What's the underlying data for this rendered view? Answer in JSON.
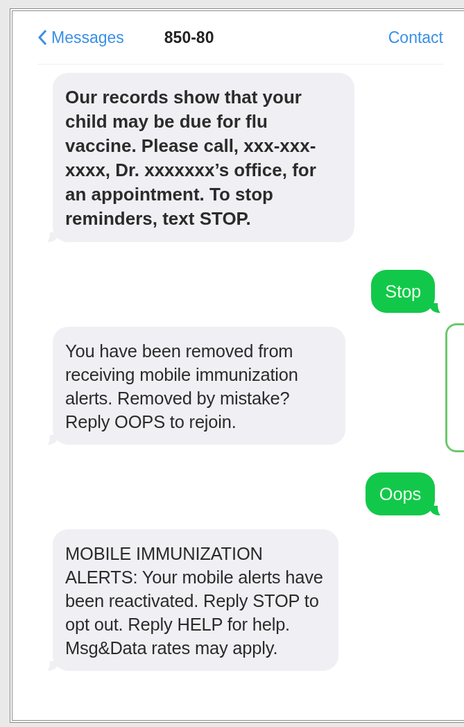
{
  "header": {
    "back": "Messages",
    "title": "850-80",
    "action": "Contact"
  },
  "messages": [
    {
      "kind": "incoming",
      "bold": true,
      "text": "Our records show that your child may be due for flu vaccine. Please call, xxx-xxx-xxxx, Dr. xxxxxxx’s office, for an appointment. To stop reminders, text STOP."
    },
    {
      "kind": "outgoing",
      "bold": false,
      "text": "Stop"
    },
    {
      "kind": "incoming",
      "bold": false,
      "text": "You have been removed from receiving mobile immunization alerts. Removed by mistake? Reply OOPS to rejoin."
    },
    {
      "kind": "outgoing",
      "bold": false,
      "text": "Oops"
    },
    {
      "kind": "incoming",
      "bold": false,
      "text": "MOBILE IMMUNIZATION ALERTS: Your mobile alerts have been reactivated. Reply STOP to opt out. Reply HELP for help. Msg&Data rates may apply."
    }
  ]
}
